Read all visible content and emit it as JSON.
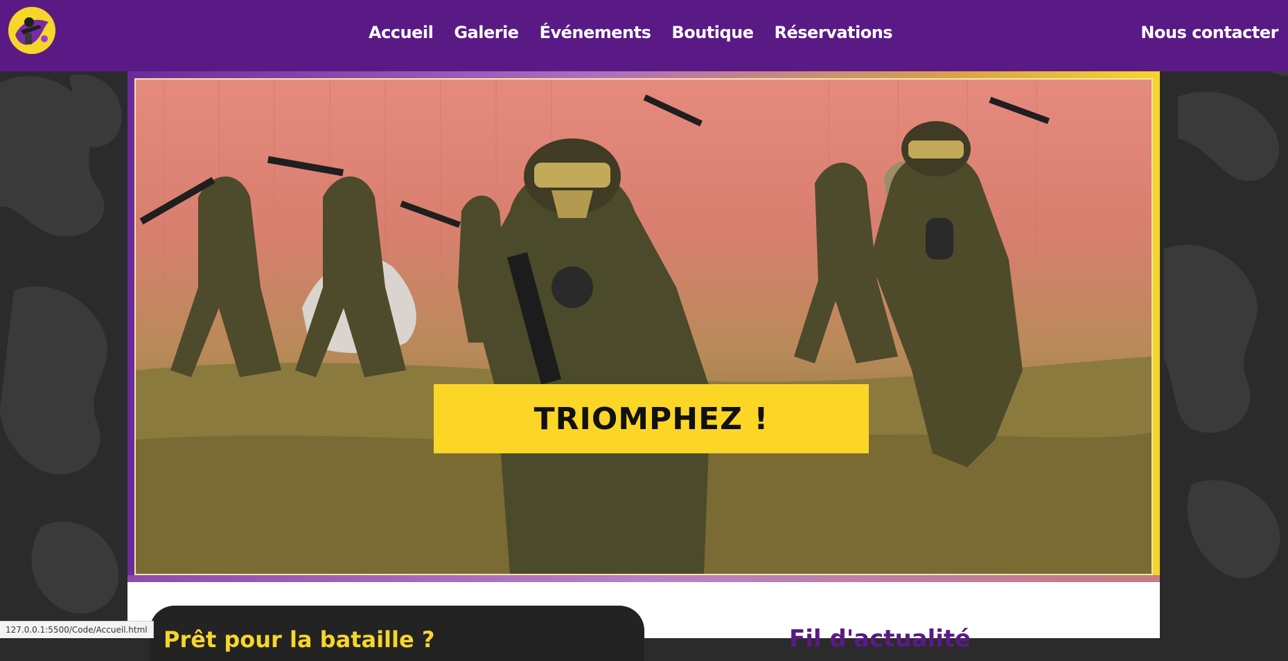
{
  "brand": {
    "logo_icon": "paintball-soldier-logo-icon"
  },
  "nav": {
    "items": [
      {
        "label": "Accueil"
      },
      {
        "label": "Galerie"
      },
      {
        "label": "Événements"
      },
      {
        "label": "Boutique"
      },
      {
        "label": "Réservations"
      }
    ],
    "contact_label": "Nous contacter"
  },
  "hero": {
    "cta_label": "TRIOMPHEZ !",
    "image_icon": "paintball-players-photo"
  },
  "section": {
    "ready_title": "Prêt pour la bataille ?",
    "news_title": "Fil d'actualité"
  },
  "statusbar": {
    "url": "127.0.0.1:5500/Code/Accueil.html"
  },
  "colors": {
    "header": "#5a1a86",
    "accent_yellow": "#fbd626",
    "dark_card": "#232323",
    "side_bg": "#2b2b2b"
  }
}
